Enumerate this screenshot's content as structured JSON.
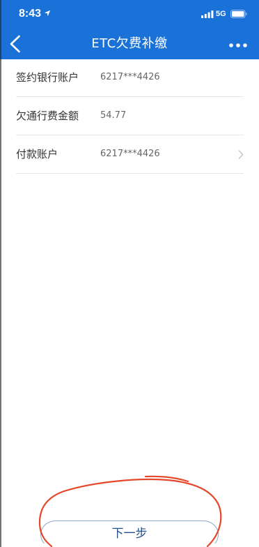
{
  "status_bar": {
    "time": "8:43",
    "network": "5G",
    "icons": [
      "location-arrow-icon",
      "signal-bars-icon",
      "battery-icon"
    ]
  },
  "nav_bar": {
    "title": "ETC欠费补缴",
    "back_icon": "chevron-left-icon",
    "more_icon": "more-dots-icon"
  },
  "form": {
    "rows": [
      {
        "label": "签约银行账户",
        "value": "6217***4426"
      },
      {
        "label": "欠通行费金额",
        "value": "54.77"
      },
      {
        "label": "付款账户",
        "value": "6217***4426",
        "trailing_icon": "chevron-right-icon"
      }
    ]
  },
  "footer": {
    "next_button_label": "下一步"
  },
  "colors": {
    "header_background": "#1a72d8",
    "header_text": "#ffffff",
    "label_text": "#333333",
    "value_text": "#666666",
    "divider": "#e6e6e6",
    "button_text": "#264f93",
    "button_border": "#8fa8cc",
    "annotation_red": "#e4472c"
  }
}
